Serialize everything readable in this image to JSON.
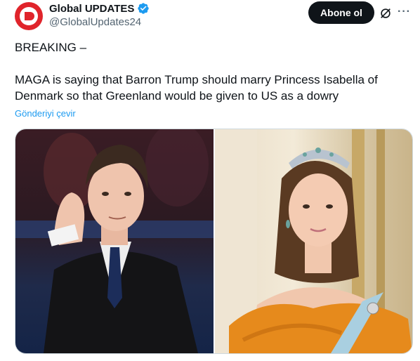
{
  "author": {
    "display_name": "Global UPDATES",
    "handle": "@GlobalUpdates24",
    "verified_icon": "verified-badge-icon",
    "avatar_color": "#e0242b"
  },
  "actions": {
    "follow_label": "Abone ol",
    "grok_icon": "grok-icon",
    "more_icon": "more-options-icon"
  },
  "tweet": {
    "line1": "BREAKING –",
    "line2": "MAGA is saying that Barron Trump should marry Princess Isabella of Denmark so that Greenland would be given to US as a dowry",
    "translate_label": "Gönderiyi çevir"
  },
  "colors": {
    "text": "#0f1419",
    "secondary": "#536471",
    "link": "#1d9bf0",
    "button": "#0f1419"
  }
}
